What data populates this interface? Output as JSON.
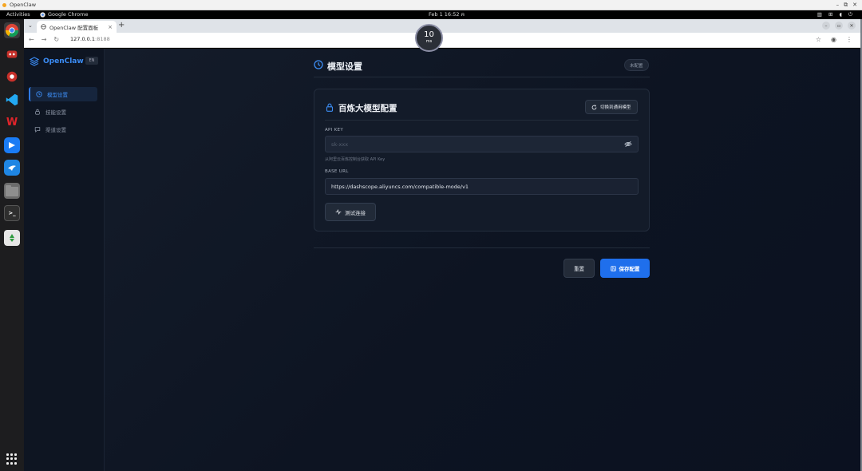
{
  "window": {
    "title": "OpenClaw",
    "controls": [
      "–",
      "⧉",
      "✕"
    ]
  },
  "system_bar": {
    "activities": "Activities",
    "app": "Google Chrome",
    "clock": "Feb 1  16:52"
  },
  "dock": {
    "items": [
      "chrome-icon",
      "ai-icon-1",
      "ai-icon-2",
      "vscode-icon",
      "wps-icon",
      "feishu-icon",
      "bird-icon",
      "files-icon",
      "terminal-icon",
      "trash-icon",
      "show-apps-icon"
    ]
  },
  "browser": {
    "tab_title": "OpenClaw 配置面板",
    "tab_close": "×",
    "new_tab": "+",
    "url_host": "127.0.0.1",
    "url_port": ":8188"
  },
  "latency": {
    "value": "10",
    "unit": "ms"
  },
  "sidebar": {
    "brand": "OpenClaw",
    "lang": "EN",
    "items": [
      {
        "label": "模型设置",
        "icon": "clock-icon",
        "active": true
      },
      {
        "label": "技能设置",
        "icon": "lock-icon",
        "active": false
      },
      {
        "label": "渠道设置",
        "icon": "chat-icon",
        "active": false
      }
    ]
  },
  "header": {
    "title": "模型设置",
    "status": "未配置"
  },
  "card": {
    "title": "百炼大模型配置",
    "switch_button": "切换到通用模型",
    "api_key_label": "API KEY",
    "api_key_placeholder": "sk-xxx",
    "api_key_hint": "从阿里云百炼控制台获取 API Key",
    "base_url_label": "BASE URL",
    "base_url_value": "https://dashscope.aliyuncs.com/compatible-mode/v1",
    "test_button": "测试连接"
  },
  "actions": {
    "reset": "重置",
    "save": "保存配置"
  },
  "colors": {
    "accent": "#1f6fec",
    "brand": "#3b8cf5",
    "background": "#0d1422",
    "card": "#131b29"
  }
}
